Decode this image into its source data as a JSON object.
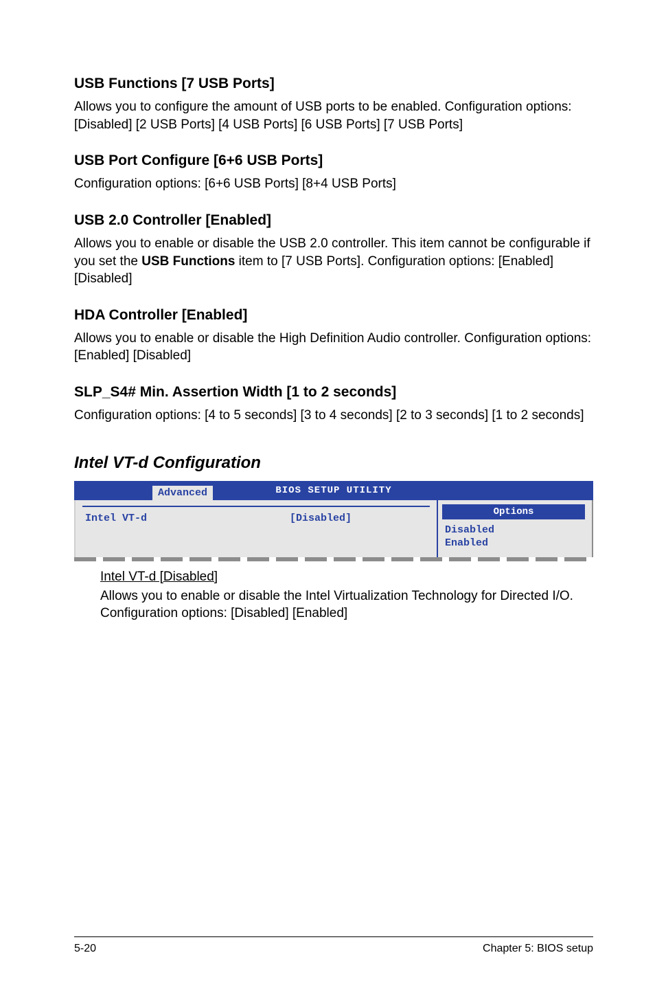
{
  "sections": {
    "usb_functions": {
      "heading": "USB Functions [7 USB Ports]",
      "body": "Allows you to configure the amount of USB ports to be enabled. Configuration options: [Disabled] [2 USB Ports] [4 USB Ports] [6 USB Ports] [7 USB Ports]"
    },
    "usb_port_configure": {
      "heading": "USB Port Configure [6+6 USB Ports]",
      "body": "Configuration options: [6+6 USB Ports] [8+4 USB Ports]"
    },
    "usb_20_controller": {
      "heading": "USB 2.0 Controller [Enabled]",
      "body_1": "Allows you to enable or disable the USB 2.0 controller. This item cannot be configurable if you set the ",
      "body_bold": "USB Functions",
      "body_2": " item to [7 USB Ports]. Configuration options: [Enabled] [Disabled]"
    },
    "hda_controller": {
      "heading": "HDA Controller [Enabled]",
      "body": "Allows you to enable or disable the High Definition Audio controller. Configuration options: [Enabled] [Disabled]"
    },
    "slp_s4": {
      "heading": "SLP_S4# Min. Assertion Width [1 to 2 seconds]",
      "body": "Configuration options: [4 to 5 seconds] [3 to 4 seconds] [2 to 3 seconds] [1 to 2 seconds]"
    },
    "intel_vtd": {
      "heading": "Intel VT-d Configuration",
      "sub_heading": "Intel VT-d [Disabled]",
      "sub_body": "Allows you to enable or disable the Intel Virtualization Technology for Directed I/O.\nConfiguration options: [Disabled] [Enabled]"
    }
  },
  "bios": {
    "title": "BIOS SETUP UTILITY",
    "tab": "Advanced",
    "setting_label": "Intel VT-d",
    "setting_value": "[Disabled]",
    "options_header": "Options",
    "options": [
      "Disabled",
      "Enabled"
    ]
  },
  "footer": {
    "left": "5-20",
    "right": "Chapter 5: BIOS setup"
  }
}
